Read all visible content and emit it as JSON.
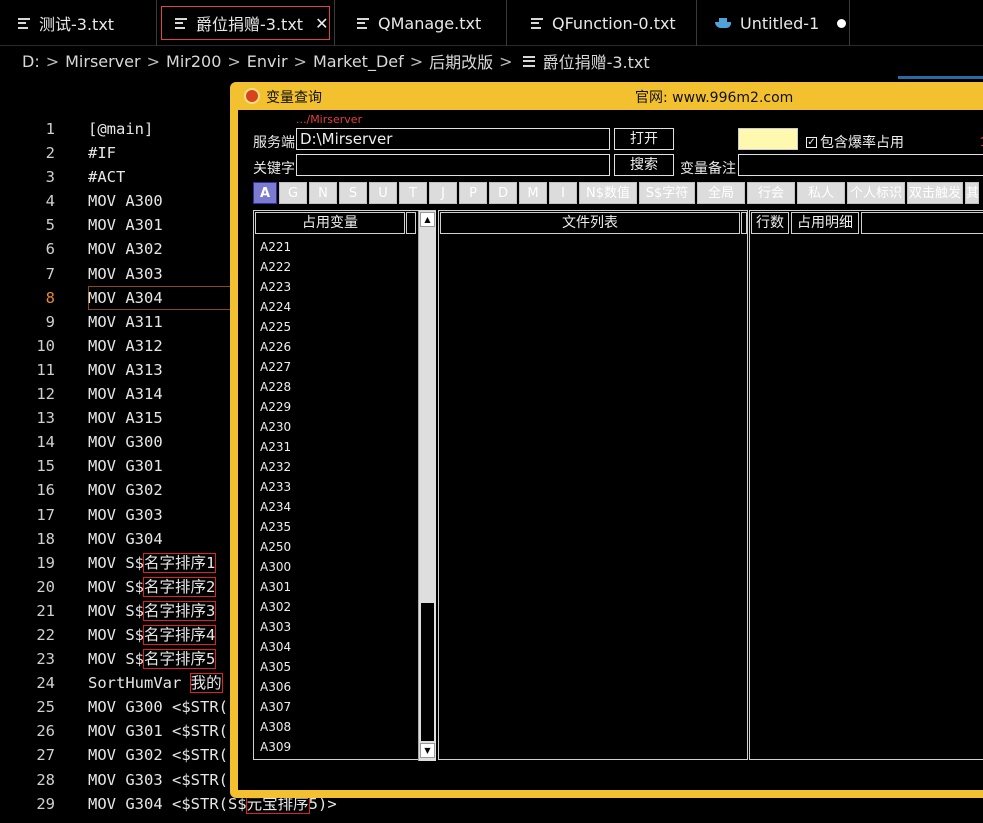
{
  "tabs": [
    {
      "label": "测试-3.txt",
      "icon": "text-file-icon"
    },
    {
      "label": "爵位捐赠-3.txt",
      "icon": "text-file-icon",
      "active": true
    },
    {
      "label": "QManage.txt",
      "icon": "text-file-icon"
    },
    {
      "label": "QFunction-0.txt",
      "icon": "text-file-icon"
    },
    {
      "label": "Untitled-1",
      "icon": "docker-whale-icon",
      "modified": true
    }
  ],
  "breadcrumb": [
    "D:",
    "Mirserver",
    "Mir200",
    "Envir",
    "Market_Def",
    "后期改版",
    "爵位捐赠-3.txt"
  ],
  "editor": {
    "current_line": 8,
    "lines": [
      {
        "n": "1",
        "t": "[@main]"
      },
      {
        "n": "2",
        "t": "#IF"
      },
      {
        "n": "3",
        "t": "#ACT"
      },
      {
        "n": "4",
        "t": "MOV A300"
      },
      {
        "n": "5",
        "t": "MOV A301"
      },
      {
        "n": "6",
        "t": "MOV A302"
      },
      {
        "n": "7",
        "t": "MOV A303"
      },
      {
        "n": "8",
        "t": "MOV A304"
      },
      {
        "n": "9",
        "t": "MOV A311"
      },
      {
        "n": "10",
        "t": "MOV A312"
      },
      {
        "n": "11",
        "t": "MOV A313"
      },
      {
        "n": "12",
        "t": "MOV A314"
      },
      {
        "n": "13",
        "t": "MOV A315"
      },
      {
        "n": "14",
        "t": "MOV G300"
      },
      {
        "n": "15",
        "t": "MOV G301"
      },
      {
        "n": "16",
        "t": "MOV G302"
      },
      {
        "n": "17",
        "t": "MOV G303"
      },
      {
        "n": "18",
        "t": "MOV G304"
      },
      {
        "n": "19",
        "t": "MOV S$",
        "h": "名字排序1"
      },
      {
        "n": "20",
        "t": "MOV S$",
        "h": "名字排序2"
      },
      {
        "n": "21",
        "t": "MOV S$",
        "h": "名字排序3"
      },
      {
        "n": "22",
        "t": "MOV S$",
        "h": "名字排序4"
      },
      {
        "n": "23",
        "t": "MOV S$",
        "h": "名字排序5"
      },
      {
        "n": "24",
        "t": "SortHumVar ",
        "h": "我的"
      },
      {
        "n": "25",
        "t": "MOV G300 <$STR("
      },
      {
        "n": "26",
        "t": "MOV G301 <$STR("
      },
      {
        "n": "27",
        "t": "MOV G302 <$STR("
      },
      {
        "n": "28",
        "t": "MOV G303 <$STR("
      },
      {
        "n": "29",
        "t": "MOV G304 <$STR(S$",
        "h": "元宝排序",
        "tail": "5)>"
      }
    ]
  },
  "dialog": {
    "title": "变量查询",
    "website": "官网: www.996m2.com",
    "path_hint": ".../Mirserver",
    "server_label": "服务端",
    "server_value": "D:\\Mirserver",
    "open_button": "打开",
    "include_label": "包含爆率占用",
    "edge_mark": "全",
    "keyword_label": "关键字",
    "keyword_value": "",
    "search_button": "搜索",
    "remark_label": "变量备注",
    "remark_value": "",
    "filters": [
      "A",
      "G",
      "N",
      "S",
      "U",
      "T",
      "J",
      "P",
      "D",
      "M",
      "I",
      "N$数值",
      "S$字符",
      "全局",
      "行会",
      "私人",
      "个人标识",
      "双击触发",
      "其"
    ],
    "selected_filter": "A",
    "col_used_vars": "占用变量",
    "col_file_list": "文件列表",
    "col_line_count": "行数",
    "col_usage_detail": "占用明细",
    "variables": [
      "A221",
      "A222",
      "A223",
      "A224",
      "A225",
      "A226",
      "A227",
      "A228",
      "A229",
      "A230",
      "A231",
      "A232",
      "A233",
      "A234",
      "A235",
      "A250",
      "A300",
      "A301",
      "A302",
      "A303",
      "A304",
      "A305",
      "A306",
      "A307",
      "A308",
      "A309"
    ]
  }
}
